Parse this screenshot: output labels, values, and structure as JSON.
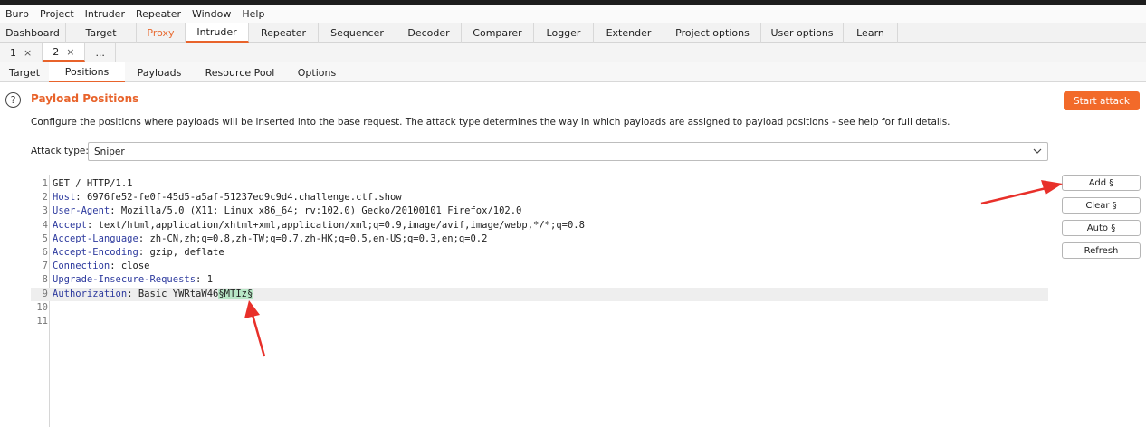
{
  "menu": [
    "Burp",
    "Project",
    "Intruder",
    "Repeater",
    "Window",
    "Help"
  ],
  "main_tabs": [
    {
      "label": "Dashboard"
    },
    {
      "label": "Target"
    },
    {
      "label": "Proxy"
    },
    {
      "label": "Intruder"
    },
    {
      "label": "Repeater"
    },
    {
      "label": "Sequencer"
    },
    {
      "label": "Decoder"
    },
    {
      "label": "Comparer"
    },
    {
      "label": "Logger"
    },
    {
      "label": "Extender"
    },
    {
      "label": "Project options"
    },
    {
      "label": "User options"
    },
    {
      "label": "Learn"
    }
  ],
  "attack_tabs": [
    {
      "label": "1",
      "close": "×"
    },
    {
      "label": "2",
      "close": "×"
    },
    {
      "label": "..."
    }
  ],
  "inner_tabs": [
    "Target",
    "Positions",
    "Payloads",
    "Resource Pool",
    "Options"
  ],
  "panel": {
    "help_symbol": "?",
    "title": "Payload Positions",
    "description": "Configure the positions where payloads will be inserted into the base request. The attack type determines the way in which payloads are assigned to payload positions - see help for full details.",
    "start_attack": "Start attack",
    "attack_type_label": "Attack type:",
    "attack_type_value": "Sniper"
  },
  "request_lines": [
    {
      "num": "1",
      "name": "",
      "sep": "",
      "value": "GET / HTTP/1.1"
    },
    {
      "num": "2",
      "name": "Host",
      "sep": ": ",
      "value": "6976fe52-fe0f-45d5-a5af-51237ed9c9d4.challenge.ctf.show"
    },
    {
      "num": "3",
      "name": "User-Agent",
      "sep": ": ",
      "value": "Mozilla/5.0 (X11; Linux x86_64; rv:102.0) Gecko/20100101 Firefox/102.0"
    },
    {
      "num": "4",
      "name": "Accept",
      "sep": ": ",
      "value": "text/html,application/xhtml+xml,application/xml;q=0.9,image/avif,image/webp,*/*;q=0.8"
    },
    {
      "num": "5",
      "name": "Accept-Language",
      "sep": ": ",
      "value": "zh-CN,zh;q=0.8,zh-TW;q=0.7,zh-HK;q=0.5,en-US;q=0.3,en;q=0.2"
    },
    {
      "num": "6",
      "name": "Accept-Encoding",
      "sep": ": ",
      "value": "gzip, deflate"
    },
    {
      "num": "7",
      "name": "Connection",
      "sep": ": ",
      "value": "close"
    },
    {
      "num": "8",
      "name": "Upgrade-Insecure-Requests",
      "sep": ": ",
      "value": "1"
    },
    {
      "num": "9",
      "name": "Authorization",
      "sep": ": ",
      "value": "Basic YWRtaW46",
      "marker": "§MTIz§"
    },
    {
      "num": "10",
      "name": "",
      "sep": "",
      "value": ""
    },
    {
      "num": "11",
      "name": "",
      "sep": "",
      "value": ""
    }
  ],
  "side_buttons": {
    "add": "Add §",
    "clear": "Clear §",
    "auto": "Auto §",
    "refresh": "Refresh"
  },
  "colors": {
    "accent": "#e8632b",
    "start_button": "#f26a2a",
    "header_name": "#2d3a9e",
    "payload_marker": "#b8e6c6",
    "annotation_arrow": "#e8302a"
  }
}
